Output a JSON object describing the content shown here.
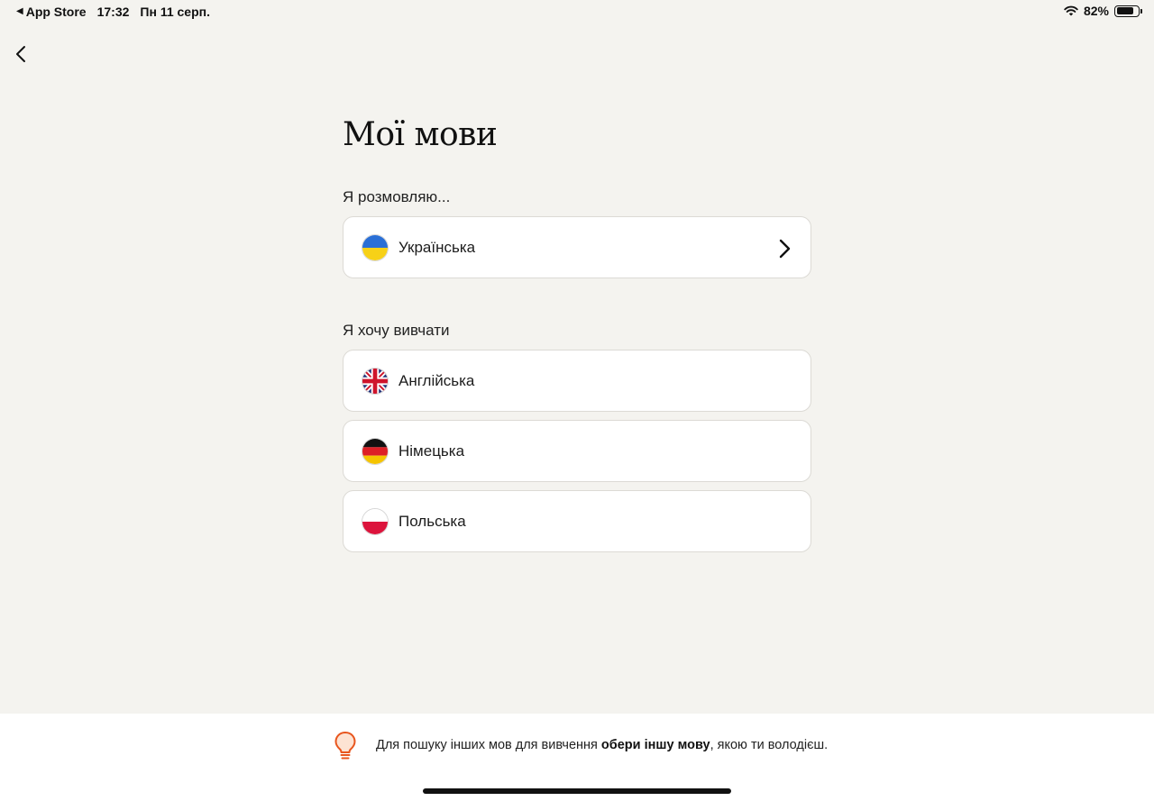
{
  "status_bar": {
    "back_app": "App Store",
    "time": "17:32",
    "date": "Пн 11 серп.",
    "battery": "82%",
    "battery_level": 0.82
  },
  "page": {
    "title": "Мої мови"
  },
  "speak_section": {
    "label": "Я розмовляю...",
    "language": {
      "name": "Українська",
      "flag_icon": "ukraine-flag-icon"
    }
  },
  "learn_section": {
    "label": "Я хочу вивчати",
    "languages": [
      {
        "name": "Англійська",
        "flag_icon": "uk-flag-icon"
      },
      {
        "name": "Німецька",
        "flag_icon": "germany-flag-icon"
      },
      {
        "name": "Польська",
        "flag_icon": "poland-flag-icon"
      }
    ]
  },
  "footer_tip": {
    "text_before": "Для пошуку інших мов для вивчення ",
    "text_bold": "обери іншу мову",
    "text_after": ", якою ти володієш.",
    "icon": "lightbulb-icon",
    "icon_color": "#e8561e"
  }
}
